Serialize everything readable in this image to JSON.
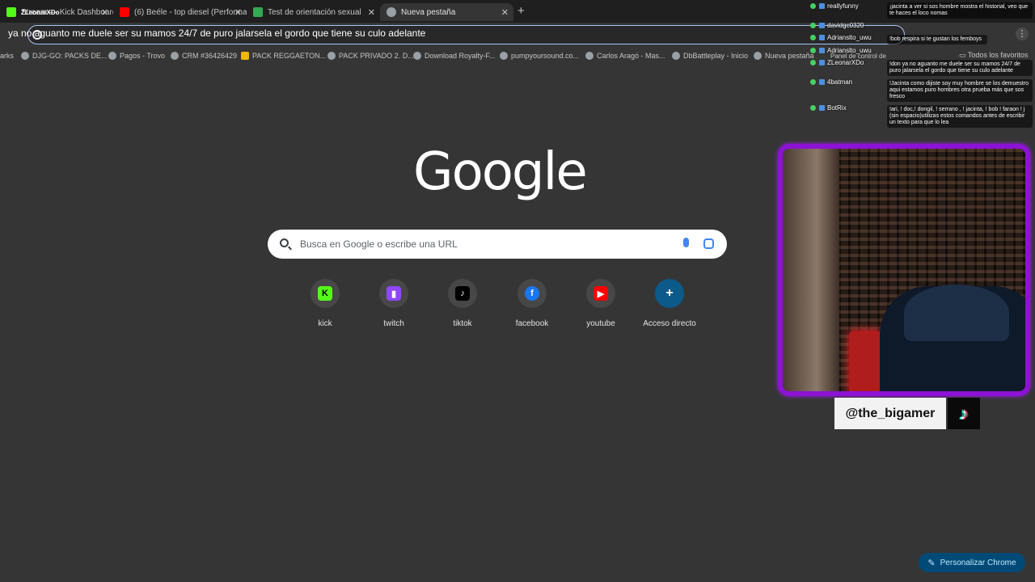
{
  "tabs": [
    {
      "label": "Stream — Kick Dashboard",
      "favicon_color": "#53fc18"
    },
    {
      "label": "(6) Beéle - top diesel (Performa",
      "favicon_color": "#ff0000"
    },
    {
      "label": "Test de orientación sexual",
      "favicon_color": "#34a853"
    },
    {
      "label": "Nueva pestaña",
      "favicon_color": "#9aa0a6"
    }
  ],
  "tab_overlay_name": "ZLeonarXDo",
  "omnibox": {
    "value": "ya no aguanto me duele ser su mamos 24/7 de puro jalarsela el gordo que tiene su culo adelante"
  },
  "bookmarks": [
    {
      "label": "arks"
    },
    {
      "label": "DJG-GO: PACKS DE..."
    },
    {
      "label": "Pagos - Trovo"
    },
    {
      "label": "CRM #36426429"
    },
    {
      "label": "PACK REGGAETON..."
    },
    {
      "label": "PACK PRIVADO 2. D..."
    },
    {
      "label": "Download Royalty-F..."
    },
    {
      "label": "pumpyoursound.co..."
    },
    {
      "label": "Carlos Aragó - Mas..."
    },
    {
      "label": "DbBattleplay - Inicio"
    },
    {
      "label": "Nueva pestaña"
    }
  ],
  "favorites_folder": "Todos los favoritos",
  "google": {
    "logo": "Google",
    "search_placeholder": "Busca en Google o escribe una URL"
  },
  "shortcuts": [
    {
      "label": "kick",
      "icon": "kick-icon",
      "glyph": "K",
      "color": "#53fc18",
      "fg": "#000000"
    },
    {
      "label": "twitch",
      "icon": "twitch-icon",
      "glyph": "▮",
      "color": "#9146ff",
      "fg": "#ffffff"
    },
    {
      "label": "tiktok",
      "icon": "tiktok-icon",
      "glyph": "♪",
      "color": "#000000",
      "fg": "#ffffff"
    },
    {
      "label": "facebook",
      "icon": "facebook-icon",
      "glyph": "f",
      "color": "#1877f2",
      "fg": "#ffffff"
    },
    {
      "label": "youtube",
      "icon": "youtube-icon",
      "glyph": "▶",
      "color": "#ff0000",
      "fg": "#ffffff"
    },
    {
      "label": "Acceso directo",
      "icon": "plus-icon",
      "glyph": "+",
      "color": "transparent",
      "fg": "#ffffff"
    }
  ],
  "chat": {
    "users": [
      {
        "name": "reallyfunny"
      },
      {
        "name": "davidgc0320"
      },
      {
        "name": "Adrianslto_uwu"
      },
      {
        "name": "Adrianslto_uwu"
      },
      {
        "name": "ZLeonarXDo"
      },
      {
        "name": "4batman"
      },
      {
        "name": "BotRix"
      }
    ],
    "messages": [
      {
        "text": "¡jacinta a ver si sos hombre mostra el historial, veo que te haces el loco nomas"
      },
      {
        "text": "!bob respira si te gustan los femboys"
      },
      {
        "text": "!don ya no aguanto me duele ser su mamos 24/7 de puro jalarsela el gordo que tiene su culo adelante"
      },
      {
        "text": "!Jacinta como dijiste soy muy hombre se los demuestro aqui estamos puro hombres otra prueba más que sos fresco"
      },
      {
        "text": "!ari, ! doc,! dongil, ! serrano , ! jacinta, ! bob ! faraon ! j (sin espacio)utilizas estos comandos antes de escribir un texto para que lo lea"
      }
    ],
    "extra_label": "Panel de control de"
  },
  "streamer": {
    "handle": "@the_bigamer",
    "platform_icon": "tiktok-logo-icon"
  },
  "customize_button": "Personalizar Chrome",
  "colors": {
    "page_bg": "#353535",
    "tabstrip_bg": "#1f1f1f",
    "webcam_border": "#8d12d4",
    "customize_bg": "#004a77"
  }
}
